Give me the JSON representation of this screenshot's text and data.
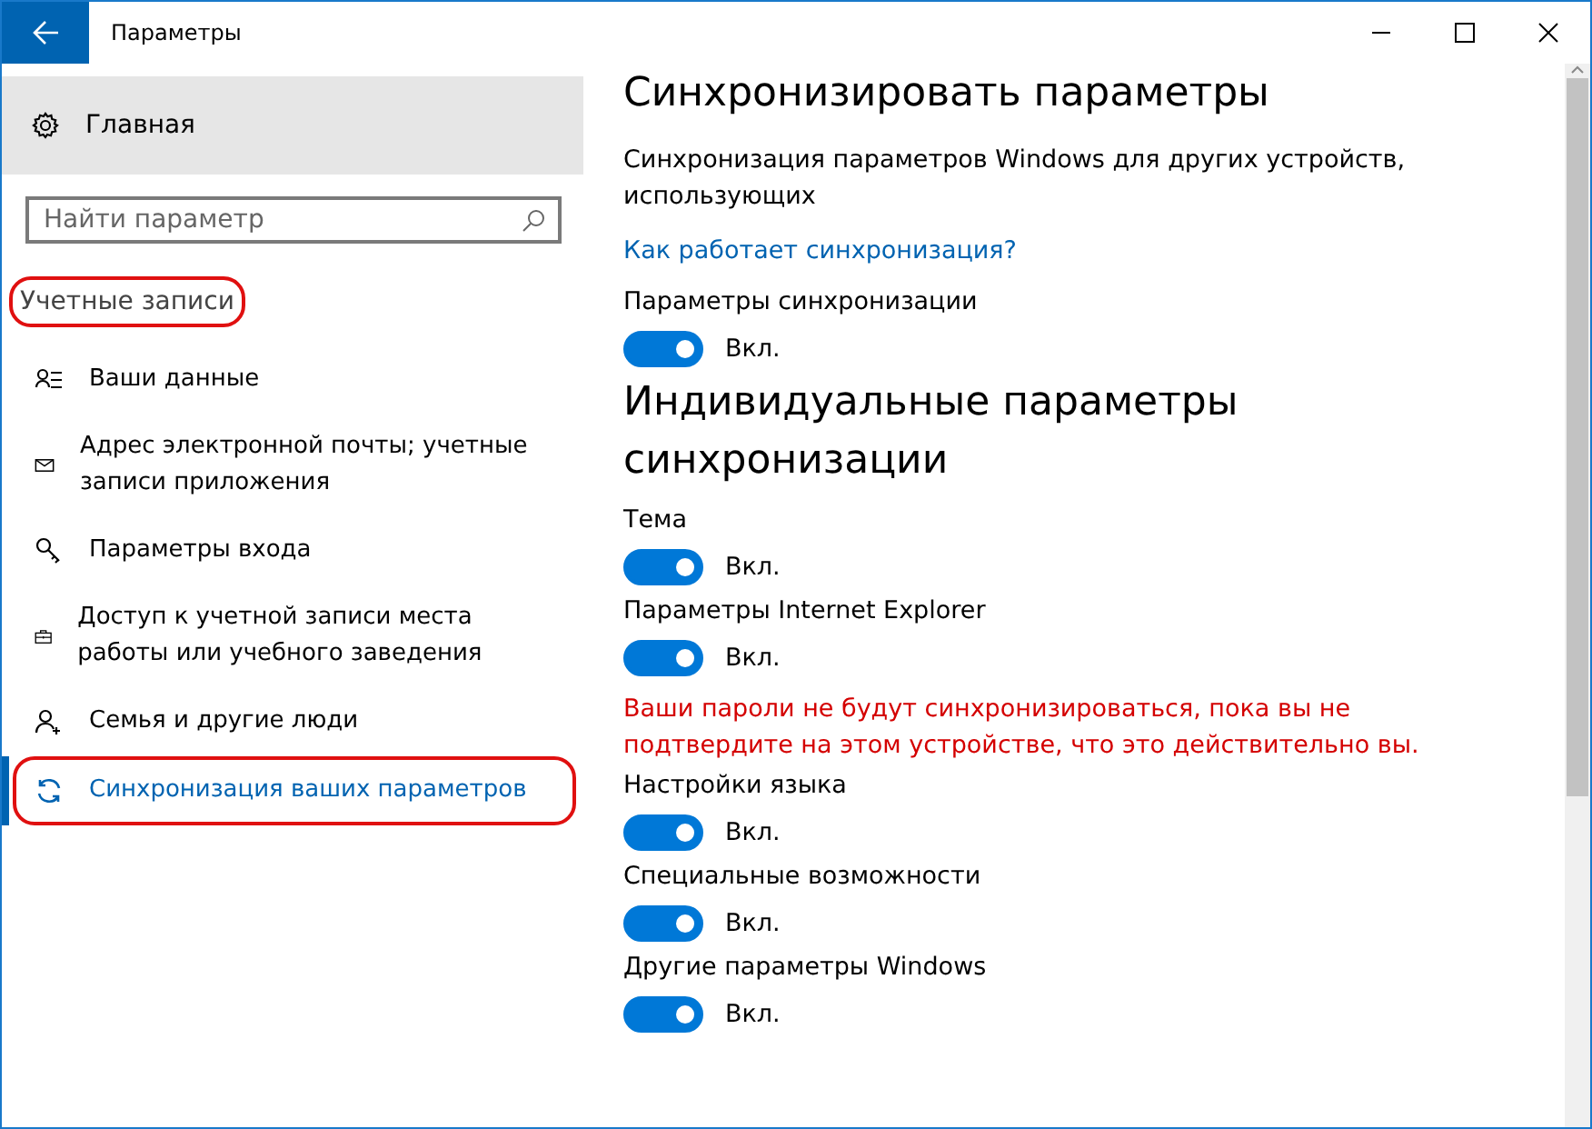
{
  "window": {
    "title": "Параметры"
  },
  "sidebar": {
    "home": "Главная",
    "search": {
      "placeholder": "Найти параметр"
    },
    "section": {
      "label": "Учетные записи",
      "circled": true
    },
    "items": [
      {
        "label": "Ваши данные",
        "selected": false,
        "circled": false
      },
      {
        "label": "Адрес электронной почты; учетные записи приложения",
        "selected": false,
        "circled": false
      },
      {
        "label": "Параметры входа",
        "selected": false,
        "circled": false
      },
      {
        "label": "Доступ к учетной записи места работы или учебного заведения",
        "selected": false,
        "circled": false
      },
      {
        "label": "Семья и другие люди",
        "selected": false,
        "circled": false
      },
      {
        "label": "Синхронизация ваших параметров",
        "selected": true,
        "circled": true
      }
    ]
  },
  "content": {
    "title": "Синхронизировать параметры",
    "description": "Синхронизация параметров Windows для других устройств, использующих",
    "link": "Как работает синхронизация?",
    "main_toggle": {
      "label": "Параметры синхронизации",
      "on": true,
      "state": "Вкл."
    },
    "subtitle": "Индивидуальные параметры синхронизации",
    "settings": [
      {
        "kind": "toggle",
        "label": "Тема",
        "on": true,
        "state": "Вкл."
      },
      {
        "kind": "toggle",
        "label": "Параметры Internet Explorer",
        "on": true,
        "state": "Вкл."
      },
      {
        "kind": "warning",
        "text": "Ваши пароли не будут синхронизироваться, пока вы не подтвердите на этом устройстве, что это действительно вы."
      },
      {
        "kind": "toggle",
        "label": "Настройки языка",
        "on": true,
        "state": "Вкл."
      },
      {
        "kind": "toggle",
        "label": "Специальные возможности",
        "on": true,
        "state": "Вкл."
      },
      {
        "kind": "toggle",
        "label": "Другие параметры Windows",
        "on": true,
        "state": "Вкл."
      }
    ]
  }
}
